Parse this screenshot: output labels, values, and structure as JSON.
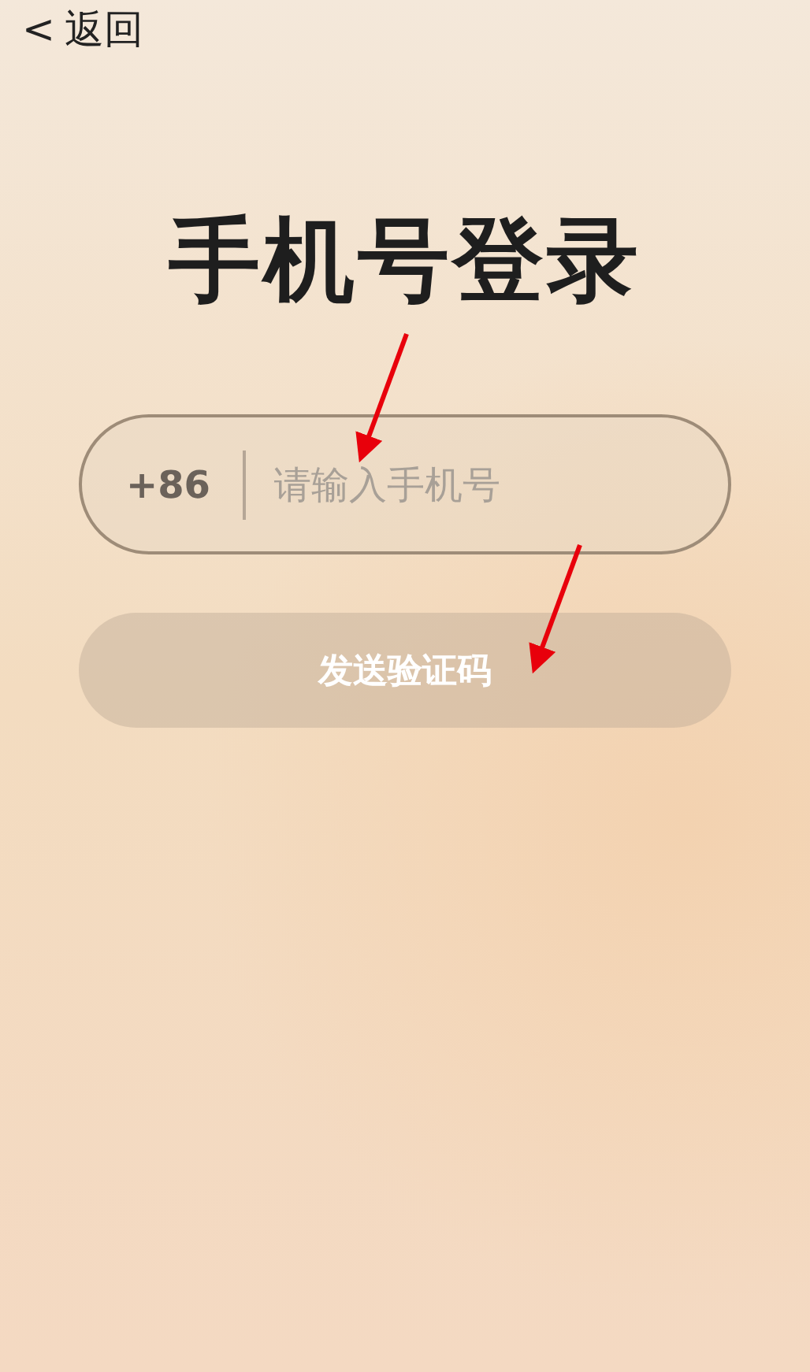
{
  "back": {
    "icon": "<",
    "label": "返回"
  },
  "title": "手机号登录",
  "phone_field": {
    "country_code": "+86",
    "placeholder": "请输入手机号"
  },
  "send_code_button": {
    "label": "发送验证码",
    "disabled": true
  }
}
